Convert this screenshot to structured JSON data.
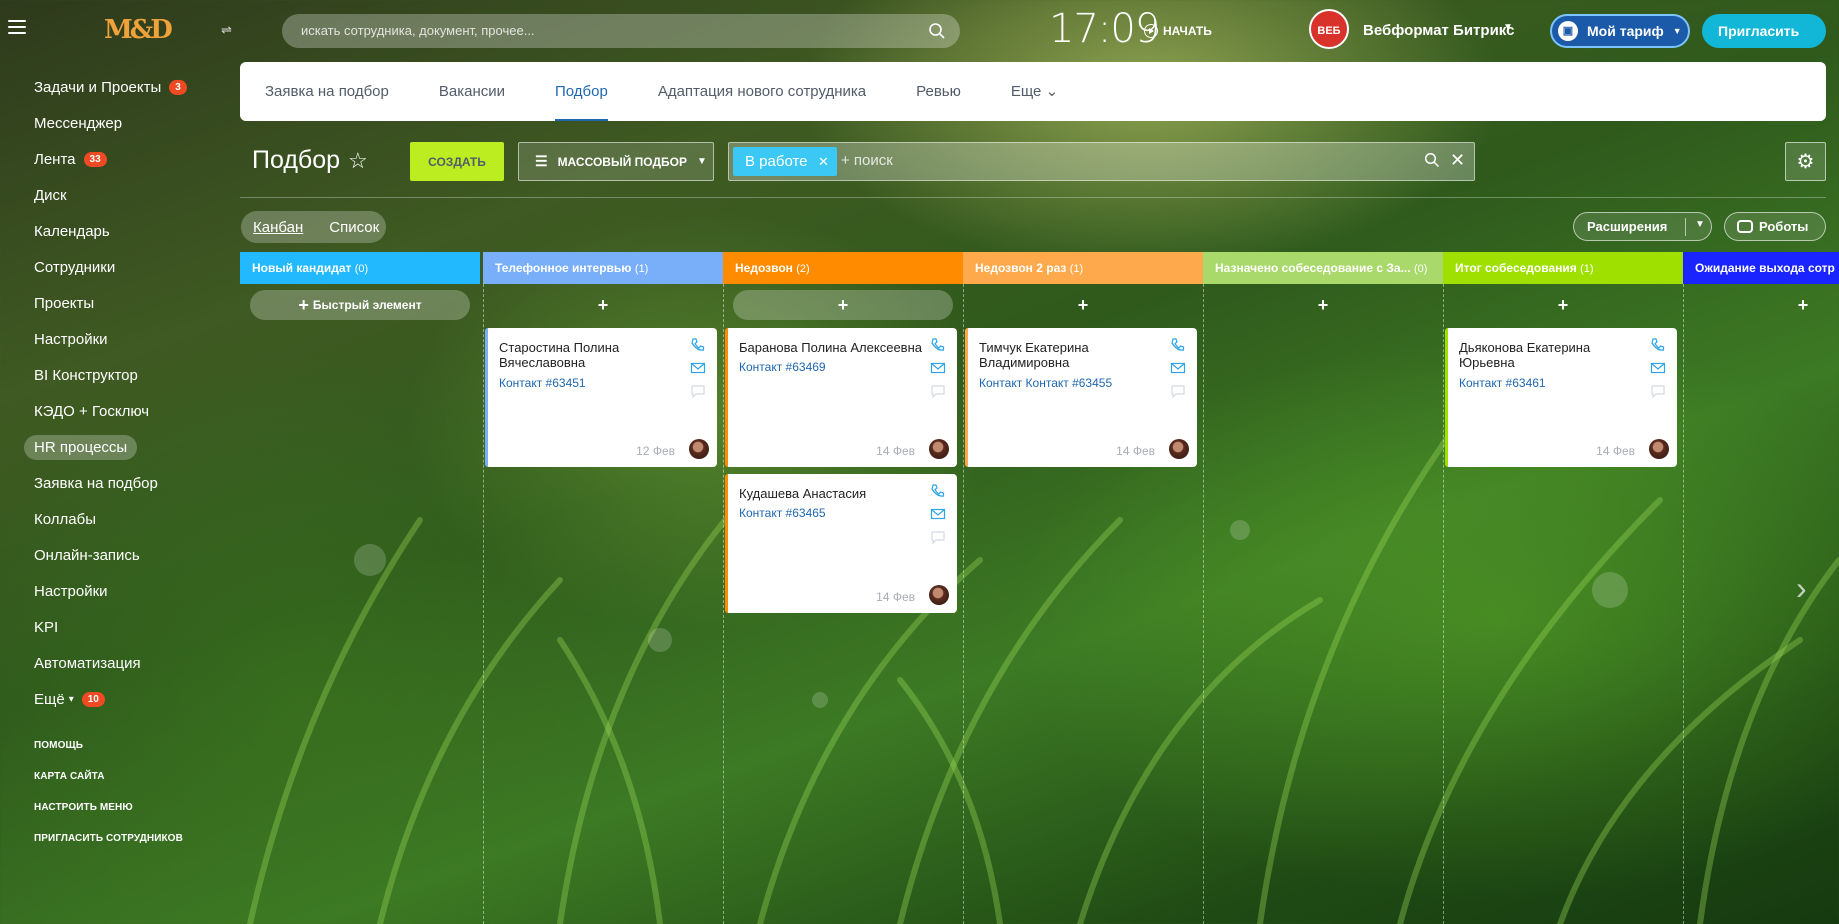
{
  "header": {
    "logo": "M&D",
    "search_placeholder": "искать сотрудника, документ, прочее...",
    "clock": "17:09",
    "start_label": "НАЧАТЬ",
    "company_logo": "ВЕБ",
    "company": "Вебформат Битрикс",
    "tariff_label": "Мой тариф",
    "invite_label": "Пригласить"
  },
  "sidebar": {
    "items": [
      {
        "label": "Задачи и Проекты",
        "badge": "3"
      },
      {
        "label": "Мессенджер",
        "badge": ""
      },
      {
        "label": "Лента",
        "badge": "33"
      },
      {
        "label": "Диск",
        "badge": ""
      },
      {
        "label": "Календарь",
        "badge": ""
      },
      {
        "label": "Сотрудники",
        "badge": ""
      },
      {
        "label": "Проекты",
        "badge": ""
      },
      {
        "label": "Настройки",
        "badge": ""
      },
      {
        "label": "BI Конструктор",
        "badge": ""
      },
      {
        "label": "КЭДО + Госключ",
        "badge": ""
      },
      {
        "label": "HR процессы",
        "badge": ""
      },
      {
        "label": "Заявка на подбор",
        "badge": ""
      },
      {
        "label": "Коллабы",
        "badge": ""
      },
      {
        "label": "Онлайн-запись",
        "badge": ""
      },
      {
        "label": "Настройки",
        "badge": ""
      },
      {
        "label": "KPI",
        "badge": ""
      },
      {
        "label": "Автоматизация",
        "badge": ""
      },
      {
        "label": "Ещё",
        "badge": "10"
      }
    ],
    "bottom": [
      "ПОМОЩЬ",
      "КАРТА САЙТА",
      "НАСТРОИТЬ МЕНЮ",
      "ПРИГЛАСИТЬ СОТРУДНИКОВ"
    ]
  },
  "tabs": [
    "Заявка на подбор",
    "Вакансии",
    "Подбор",
    "Адаптация нового сотрудника",
    "Ревью",
    "Еще"
  ],
  "toolbar": {
    "title": "Подбор",
    "create_label": "СОЗДАТЬ",
    "mass_label": "МАССОВЫЙ ПОДБОР",
    "filter_chip": "В работе",
    "filter_placeholder": "+ поиск",
    "view_kanban": "Канбан",
    "view_list": "Список",
    "extensions_label": "Расширения",
    "robots_label": "Роботы"
  },
  "colors": {
    "accent": "#2067b0",
    "create": "#bbed21",
    "chip": "#3bc8f5"
  },
  "columns": [
    {
      "title": "Новый кандидат",
      "count": "(0)",
      "color": "#22b9ff",
      "quick": "Быстрый элемент",
      "cards": []
    },
    {
      "title": "Телефонное интервью",
      "count": "(1)",
      "color": "#79aef8",
      "quick": "",
      "cards": [
        {
          "name": "Старостина Полина Вячеславовна",
          "contact": "Контакт #63451",
          "date": "12 Фев"
        }
      ]
    },
    {
      "title": "Недозвон",
      "count": "(2)",
      "color": "#ff8c00",
      "quick": "",
      "cards": [
        {
          "name": "Баранова Полина Алексеевна",
          "contact": "Контакт #63469",
          "date": "14 Фев"
        },
        {
          "name": "Кудашева Анастасия",
          "contact": "Контакт #63465",
          "date": "14 Фев"
        }
      ]
    },
    {
      "title": "Недозвон 2 раз",
      "count": "(1)",
      "color": "#ffa94d",
      "quick": "",
      "cards": [
        {
          "name": "Тимчук Екатерина Владимировна",
          "contact": "Контакт Контакт #63455",
          "date": "14 Фев"
        }
      ]
    },
    {
      "title": "Назначено собеседование с За...",
      "count": "(0)",
      "color": "#a8d96a",
      "quick": "",
      "cards": []
    },
    {
      "title": "Итог собеседования",
      "count": "(1)",
      "color": "#9fe000",
      "quick": "",
      "cards": [
        {
          "name": "Дьяконова Екатерина Юрьевна",
          "contact": "Контакт #63461",
          "date": "14 Фев"
        }
      ]
    },
    {
      "title": "Ожидание выхода сотр",
      "count": "",
      "color": "#1a24ff",
      "quick": "",
      "cards": []
    }
  ]
}
